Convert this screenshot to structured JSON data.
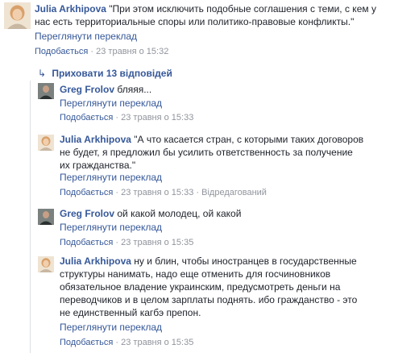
{
  "comments": [
    {
      "author": "Julia Arkhipova",
      "text_line1": "\"При этом исключить подобные соглашения с теми, с кем у",
      "text_line2": "нас есть территориальные споры или политико-правовые конфликты.\"",
      "translate": "Переглянути переклад",
      "like": "Подобається",
      "time": "23 травня о 15:32"
    },
    {
      "author": "Greg Frolov",
      "text_line1": "бляяя...",
      "translate": "Переглянути переклад",
      "like": "Подобається",
      "time": "23 травня о 15:33"
    },
    {
      "author": "Julia Arkhipova",
      "text_line1": "\"А что касается стран, с которыми таких договоров",
      "text_line2": "не будет, я предложил бы усилить ответственность за получение",
      "text_line3": "их гражданства.\"",
      "translate": "Переглянути переклад",
      "like": "Подобається",
      "time": "23 травня о 15:33",
      "edited": "Відредагований"
    },
    {
      "author": "Greg Frolov",
      "text_line1": "ой какой молодец, ой какой",
      "translate": "Переглянути переклад",
      "like": "Подобається",
      "time": "23 травня о 15:35"
    },
    {
      "author": "Julia Arkhipova",
      "text_line1": "ну и блин, чтобы иностранцев в государственные",
      "text_line2": "структуры нанимать, надо еще отменить для госчиновников",
      "text_line3": "обязательное владение украинским, предусмотреть деньги на",
      "text_line4": "переводчиков и в целом зарплаты поднять. ибо гражданство - это",
      "text_line5": "не единственный кагбэ препон.",
      "translate": "Переглянути переклад",
      "like": "Подобається",
      "time": "23 травня о 15:35"
    }
  ],
  "hide_replies": {
    "arrow": "↳",
    "label": "Приховати 13 відповідей"
  },
  "separator": "·",
  "colors": {
    "link": "#365899",
    "meta": "#90949c",
    "text": "#1d2129",
    "thread_line": "#dddfe2"
  },
  "icons": {
    "julia_avatar": "avatar-photo-icon",
    "greg_avatar": "avatar-photo-icon",
    "reply_arrow": "reply-arrow-icon"
  }
}
